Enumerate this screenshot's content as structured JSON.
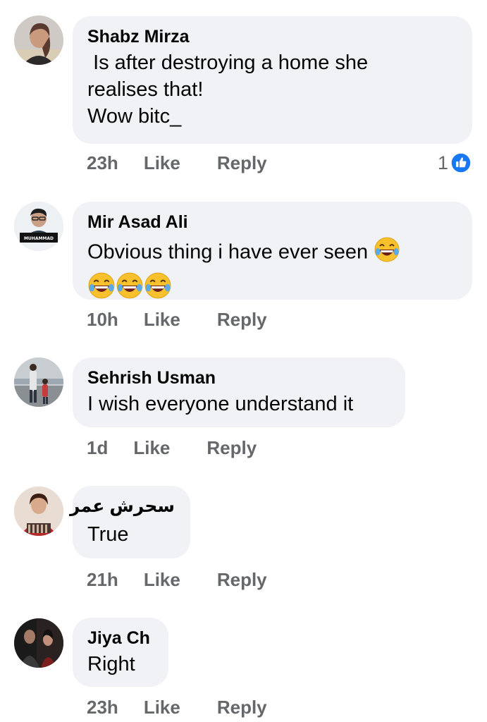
{
  "comments": [
    {
      "author": "Shabz Mirza",
      "lines": [
        " Is after destroying a home she",
        "realises that!",
        "Wow bitc_"
      ],
      "time": "23h",
      "like": "Like",
      "reply": "Reply",
      "reaction_count": "1",
      "reaction_icon": "thumbs-up-icon",
      "reaction_color": "#1877f2"
    },
    {
      "author": "Mir Asad Ali",
      "lines": [
        "Obvious thing i have ever seen"
      ],
      "emoji": "face-with-tears-of-joy",
      "time": "10h",
      "like": "Like",
      "reply": "Reply"
    },
    {
      "author": "Sehrish Usman",
      "lines": [
        "I wish everyone understand it"
      ],
      "time": "1d",
      "like": "Like",
      "reply": "Reply"
    },
    {
      "author": "سحرش عمر",
      "lines": [
        "True"
      ],
      "time": "21h",
      "like": "Like",
      "reply": "Reply"
    },
    {
      "author": "Jiya Ch",
      "lines": [
        "Right"
      ],
      "time": "23h",
      "like": "Like",
      "reply": "Reply"
    }
  ],
  "avatar_badge_text": "MUHAMMAD",
  "colors": {
    "bubble": "#f0f2f5",
    "meta": "#65676b",
    "text": "#050505",
    "like_blue": "#1877f2"
  }
}
